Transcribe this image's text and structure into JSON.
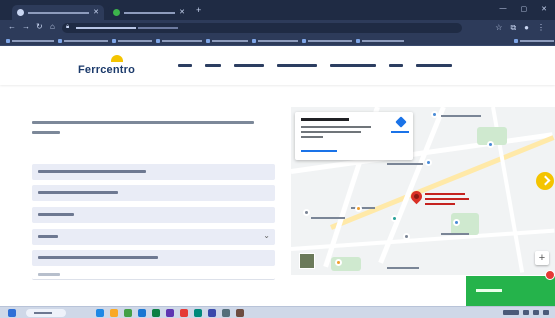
{
  "header": {
    "logo_text": "Ferrcentro"
  },
  "colors": {
    "brand_navy": "#1b3a6b",
    "brand_yellow": "#f4c400",
    "whatsapp_green": "#25b34b",
    "map_pin_red": "#d93025",
    "browser_dark": "#1f2b44"
  },
  "icons": {
    "browser": [
      "back-icon",
      "forward-icon",
      "reload-icon",
      "home-icon",
      "lock-icon",
      "star-icon",
      "extensions-icon",
      "profile-icon",
      "kebab-menu-icon"
    ],
    "form": [
      "chevron-down-icon"
    ],
    "map": [
      "directions-icon",
      "location-pin-icon",
      "zoom-in-icon"
    ],
    "page": [
      "scroll-up-icon"
    ],
    "taskbar": [
      "windows-start-icon",
      "search-icon"
    ]
  }
}
